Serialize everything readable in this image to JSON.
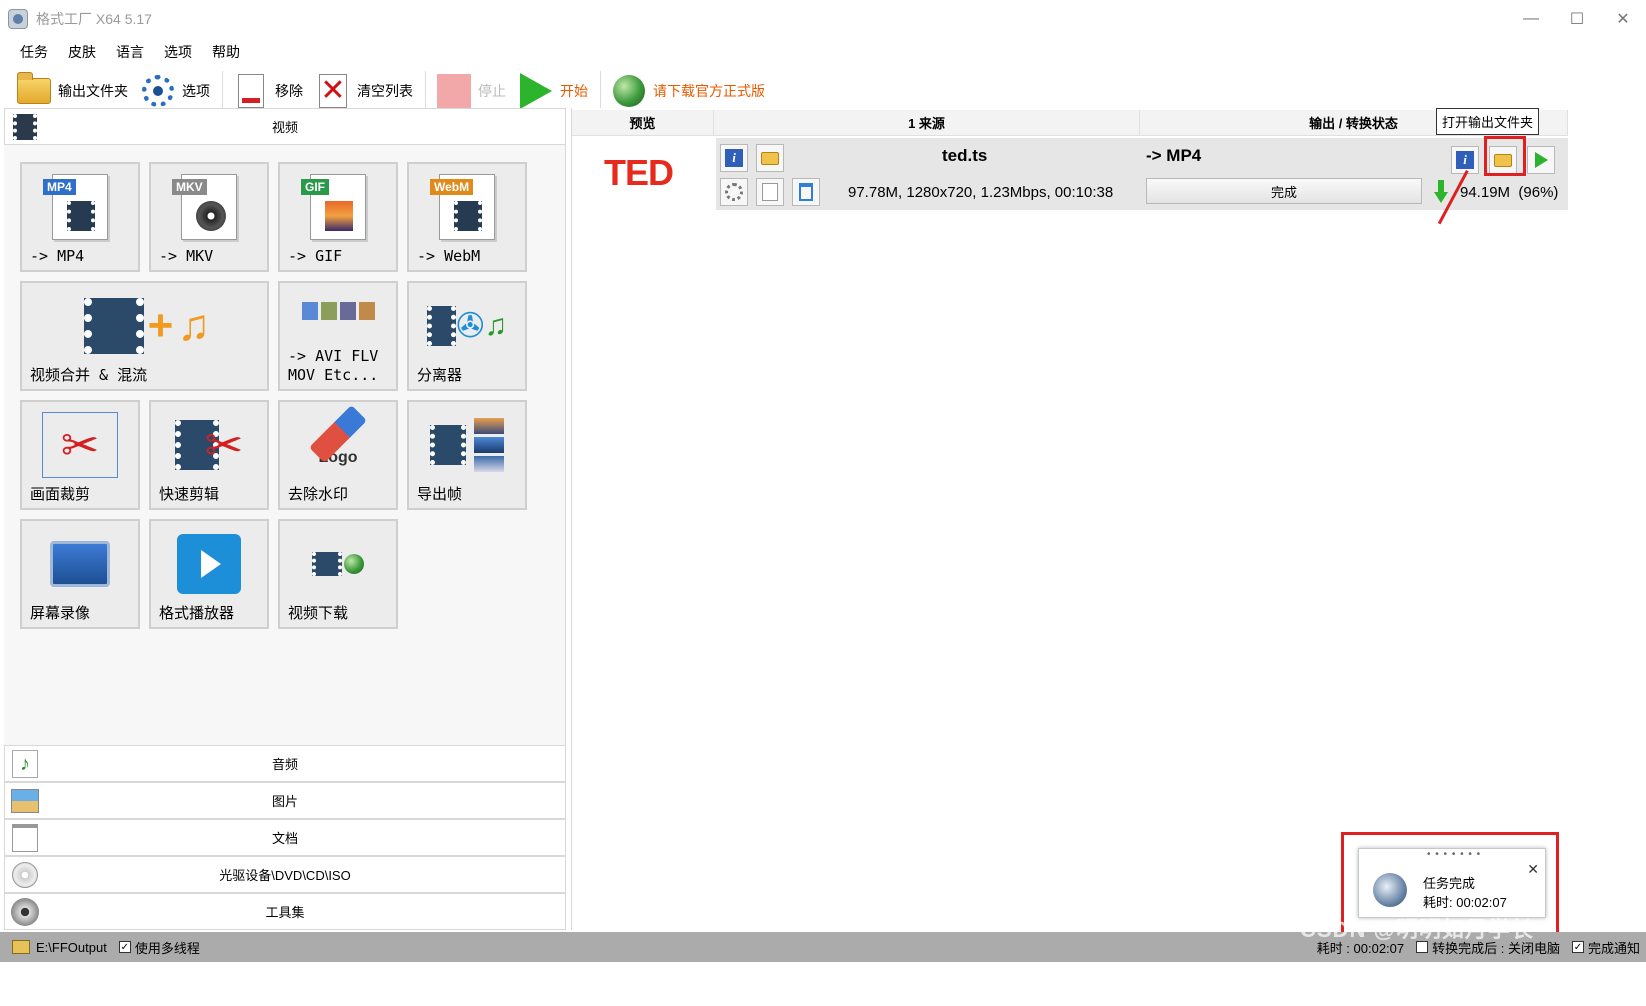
{
  "window": {
    "title": "格式工厂 X64 5.17",
    "minimize": "—",
    "maximize": "☐",
    "close": "✕"
  },
  "menu": [
    "任务",
    "皮肤",
    "语言",
    "选项",
    "帮助"
  ],
  "toolbar": {
    "output_folder": "输出文件夹",
    "options": "选项",
    "remove": "移除",
    "clear_list": "清空列表",
    "stop": "停止",
    "start": "开始",
    "download_official": "请下载官方正式版"
  },
  "categories": {
    "video": "视频",
    "audio": "音频",
    "picture": "图片",
    "document": "文档",
    "disc": "光驱设备\\DVD\\CD\\ISO",
    "tools": "工具集"
  },
  "video_tools": [
    {
      "label": "-> MP4",
      "badge": "MP4",
      "badge_color": "#2f6fc8"
    },
    {
      "label": "-> MKV",
      "badge": "MKV",
      "badge_color": "#8a8a8a"
    },
    {
      "label": "-> GIF",
      "badge": "GIF",
      "badge_color": "#2a9a4a"
    },
    {
      "label": "-> WebM",
      "badge": "WebM",
      "badge_color": "#e08a1a"
    },
    {
      "label": "视频合并 & 混流"
    },
    {
      "label": "-> AVI FLV\nMOV Etc..."
    },
    {
      "label": "分离器"
    },
    {
      "label": "画面裁剪"
    },
    {
      "label": "快速剪辑"
    },
    {
      "label": "去除水印",
      "logo_text": "Logo"
    },
    {
      "label": "导出帧"
    },
    {
      "label": "屏幕录像"
    },
    {
      "label": "格式播放器"
    },
    {
      "label": "视频下载"
    }
  ],
  "task_list": {
    "columns": {
      "preview": "预览",
      "source": "1 来源",
      "output": "输出 / 转换状态"
    },
    "job": {
      "preview_logo": "TED",
      "file_name": "ted.ts",
      "file_meta": "97.78M, 1280x720, 1.23Mbps, 00:10:38",
      "output_format": "-> MP4",
      "status": "完成",
      "output_size": "94.19M",
      "percent": "(96%)"
    }
  },
  "tooltip": "打开输出文件夹",
  "notification": {
    "dots": "• • • • • • •",
    "title": "任务完成",
    "elapsed": "耗时: 00:02:07",
    "close": "✕"
  },
  "statusbar": {
    "path": "E:\\FFOutput",
    "multithread": "使用多线程",
    "elapsed": "耗时 : 00:02:07",
    "after_done": "转换完成后 : 关闭电脑",
    "notify": "完成通知"
  },
  "watermark": "CSDN @明明如月学长"
}
